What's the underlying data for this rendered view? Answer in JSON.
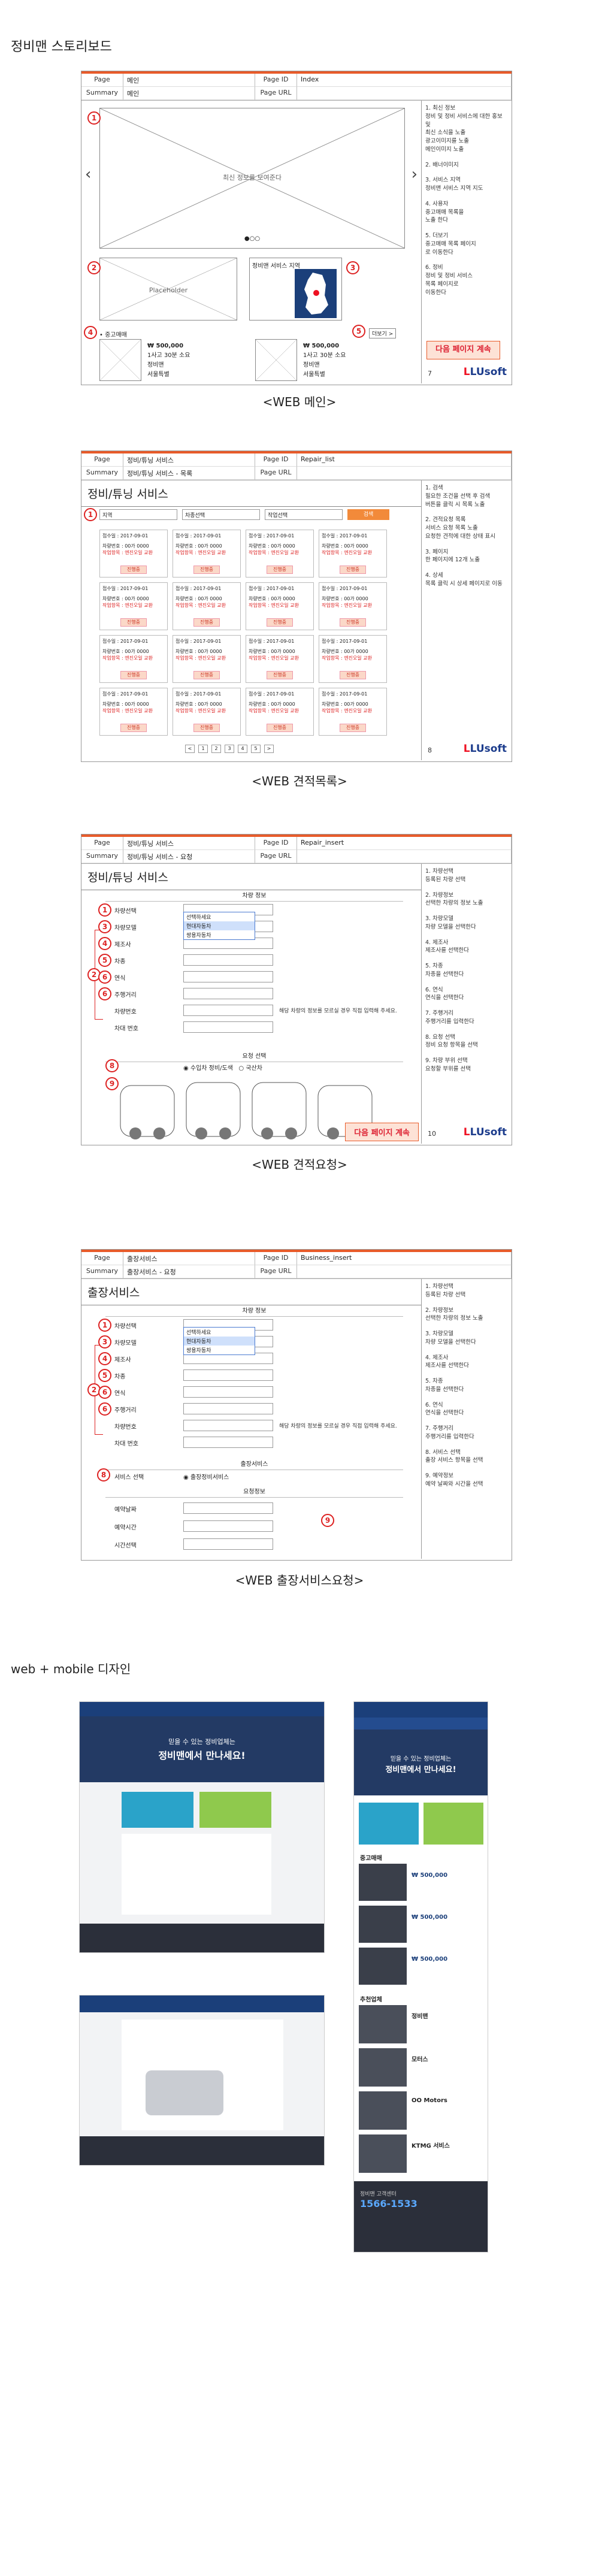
{
  "doc_title": "정비맨 스토리보드",
  "section2_title": "web + mobile 디자인",
  "header_labels": {
    "page": "Page",
    "summary": "Summary",
    "page_id": "Page ID",
    "page_url": "Page URL"
  },
  "board1": {
    "page": "메인",
    "summary": "메인",
    "page_id": "Index",
    "slide_label": "최신 정보를 보여준다",
    "placeholder": "Placeholder",
    "service_map": "정비맨 서비스 지역",
    "used_car": "• 중고매매",
    "more": "더보기 >",
    "price1": "₩ 500,000",
    "price2": "₩ 500,000",
    "spec1": "1사고 30분 소요",
    "spec2": "1사고 30분 소요",
    "shop1": "정비맨",
    "shop2": "정비맨",
    "shop3": "서울특별",
    "shop4": "서울특별",
    "next": "다음 페이지 계속",
    "logo": "LUsoft",
    "page_no": "7",
    "caption": "<WEB 메인>",
    "notes": [
      "1. 최신 정보",
      "정비 및 정비 서비스에 대한 홍보 및",
      "최신 소식을 노출",
      "광고이미지를 노출",
      "메인이미지 노출",
      "",
      "2. 배너이미지",
      "",
      "3. 서비스 지역",
      "정비맨 서비스 지역 지도",
      "",
      "4. 사용자",
      "중고매매 목록을",
      "노출 한다",
      "",
      "5. 더보기",
      "중고매매 목록 페이지",
      "로 이동한다",
      "",
      "6. 정비",
      "정비 및 정비 서비스",
      "목록 페이지로",
      "이동한다"
    ]
  },
  "board2": {
    "page": "정비/튜닝 서비스",
    "summary": "정비/튜닝 서비스 - 목록",
    "page_id": "Repair_list",
    "heading": "정비/튜닝 서비스",
    "search": "검색",
    "sel1": "지역",
    "sel2": "차종선택",
    "sel3": "작업선택",
    "card_date": "접수일 : 2017-09-01",
    "card_line1": "차량번호 : 00가 0000",
    "card_line2": "작업항목 : 엔진오일 교환",
    "card_btn": "진행중",
    "pages": [
      "<",
      "1",
      "2",
      "3",
      "4",
      "5",
      ">"
    ],
    "logo": "LUsoft",
    "page_no": "8",
    "caption": "<WEB 견적목록>",
    "notes": [
      "1. 검색",
      "필요한 조건을 선택 후 검색",
      "버튼을 클릭 시 목록 노출",
      "",
      "2. 견적요청 목록",
      "서비스 요청 목록 노출",
      "요청한 견적에 대한 상태 표시",
      "",
      "3. 페이지",
      "한 페이지에 12개 노출",
      "",
      "4. 상세",
      "목록 클릭 시 상세 페이지로 이동"
    ]
  },
  "board3": {
    "page": "정비/튜닝 서비스",
    "summary": "정비/튜닝 서비스 - 요청",
    "page_id": "Repair_insert",
    "heading": "정비/튜닝 서비스",
    "section": "차량 정보",
    "section2": "요청 선택",
    "fields": [
      "차량선택",
      "차량모델",
      "제조사",
      "차종",
      "연식",
      "주행거리",
      "차량번호",
      "차대 번호"
    ],
    "hint": "해당 차량의 정보를 모르실 경우 직접 입력해 주세요.",
    "opt1": "수입차 정비/도색",
    "opt2": "국산차",
    "dd1": "선택하세요",
    "dd2": "현대자동차",
    "dd3": "쌍용자동차",
    "next": "다음 페이지 계속",
    "logo": "LUsoft",
    "page_no": "10",
    "caption": "<WEB 견적요청>",
    "notes": [
      "1. 차량선택",
      "등록된 차량 선택",
      "",
      "2. 차량정보",
      "선택한 차량의 정보 노출",
      "",
      "3. 차량모델",
      "차량 모델을 선택한다",
      "",
      "4. 제조사",
      "제조사를 선택한다",
      "",
      "5. 차종",
      "차종을 선택한다",
      "",
      "6. 연식",
      "연식을 선택한다",
      "",
      "7. 주행거리",
      "주행거리를 입력한다",
      "",
      "8. 요청 선택",
      "정비 요청 항목을 선택",
      "",
      "9. 차량 부위 선택",
      "요청할 부위를 선택"
    ]
  },
  "board4": {
    "page": "출장서비스",
    "summary": "출장서비스 - 요청",
    "page_id": "Business_insert",
    "heading": "출장서비스",
    "section": "차량 정보",
    "section2": "출장서비스",
    "section3": "요청정보",
    "fields": [
      "차량선택",
      "차량모델",
      "제조사",
      "차종",
      "연식",
      "주행거리",
      "차량번호",
      "차대 번호"
    ],
    "sub_fields": [
      "예약날짜",
      "예약시간",
      "시간선택"
    ],
    "hint": "해당 차량의 정보를 모르실 경우 직접 입력해 주세요.",
    "dd1": "선택하세요",
    "dd2": "현대자동차",
    "dd3": "쌍용자동차",
    "service_select": "서비스 선택",
    "svc_opt": "출장정비서비스",
    "caption": "<WEB 출장서비스요청>",
    "notes": [
      "1. 차량선택",
      "등록된 차량 선택",
      "",
      "2. 차량정보",
      "선택한 차량의 정보 노출",
      "",
      "3. 차량모델",
      "차량 모델을 선택한다",
      "",
      "4. 제조사",
      "제조사를 선택한다",
      "",
      "5. 차종",
      "차종을 선택한다",
      "",
      "6. 연식",
      "연식을 선택한다",
      "",
      "7. 주행거리",
      "주행거리를 입력한다",
      "",
      "8. 서비스 선택",
      "출장 서비스 항목을 선택",
      "",
      "9. 예약정보",
      "예약 날짜와 시간을 선택"
    ]
  },
  "mobile": {
    "hero1": "믿을 수 있는 정비업체는",
    "hero2": "정비맨에서 만나세요!",
    "used": "중고매매",
    "recommend": "추천업체",
    "price": "₩ 500,000",
    "shops": [
      "정비맨",
      "모터스",
      "OO Motors",
      "KTMG 서비스"
    ],
    "cs": "정비맨 고객센터",
    "phone": "1566-1533"
  },
  "colors": {
    "accent": "#e85b2a",
    "navy": "#1b3f7a",
    "dark": "#2b2f3a",
    "red": "#d22222"
  }
}
